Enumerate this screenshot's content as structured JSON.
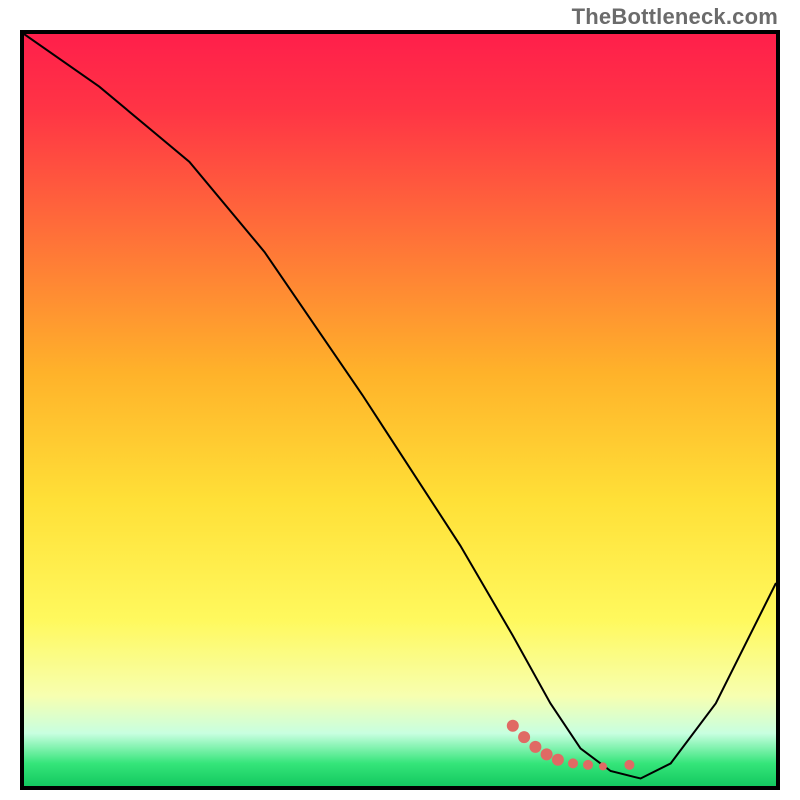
{
  "watermark": "TheBottleneck.com",
  "chart_data": {
    "type": "line",
    "title": "",
    "xlabel": "",
    "ylabel": "",
    "xlim": [
      0,
      100
    ],
    "ylim": [
      0,
      100
    ],
    "grid": false,
    "background_gradient": [
      {
        "stop": 0.0,
        "color": "#ff1f4b"
      },
      {
        "stop": 0.1,
        "color": "#ff3445"
      },
      {
        "stop": 0.25,
        "color": "#ff6a3a"
      },
      {
        "stop": 0.45,
        "color": "#ffb22a"
      },
      {
        "stop": 0.62,
        "color": "#ffe037"
      },
      {
        "stop": 0.78,
        "color": "#fff95e"
      },
      {
        "stop": 0.88,
        "color": "#f7ffb0"
      },
      {
        "stop": 0.93,
        "color": "#c8ffe0"
      },
      {
        "stop": 0.97,
        "color": "#35e57a"
      },
      {
        "stop": 1.0,
        "color": "#13c95f"
      }
    ],
    "series": [
      {
        "name": "bottleneck-curve",
        "color": "#000000",
        "stroke_width": 2,
        "x": [
          0,
          10,
          22,
          32,
          45,
          58,
          65,
          70,
          74,
          78,
          82,
          86,
          92,
          100
        ],
        "values": [
          100,
          93,
          83,
          71,
          52,
          32,
          20,
          11,
          5,
          2,
          1,
          3,
          11,
          27
        ]
      }
    ],
    "markers": [
      {
        "name": "highlight-cluster",
        "color": "#e06a64",
        "points": [
          {
            "x": 65.0,
            "y": 8.0,
            "r": 6
          },
          {
            "x": 66.5,
            "y": 6.5,
            "r": 6
          },
          {
            "x": 68.0,
            "y": 5.2,
            "r": 6
          },
          {
            "x": 69.5,
            "y": 4.2,
            "r": 6
          },
          {
            "x": 71.0,
            "y": 3.5,
            "r": 6
          },
          {
            "x": 73.0,
            "y": 3.0,
            "r": 5
          },
          {
            "x": 75.0,
            "y": 2.8,
            "r": 5
          },
          {
            "x": 77.0,
            "y": 2.6,
            "r": 4
          },
          {
            "x": 80.5,
            "y": 2.8,
            "r": 5
          }
        ]
      }
    ]
  }
}
